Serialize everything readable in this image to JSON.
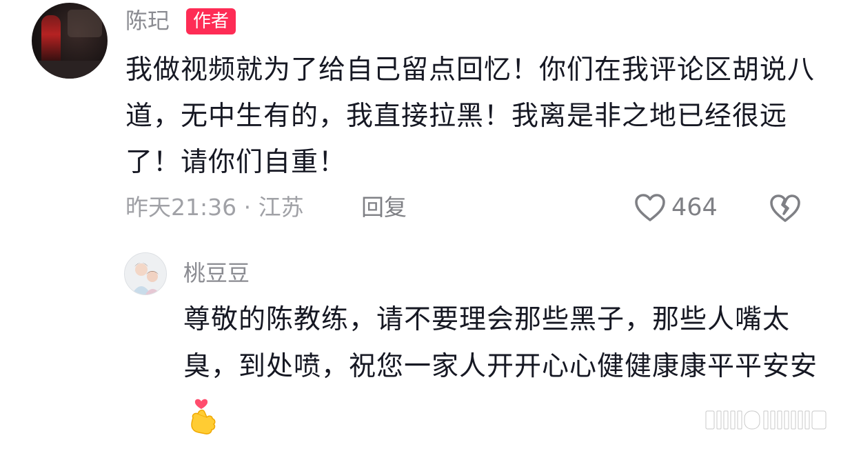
{
  "comment": {
    "author": "陈玘",
    "badge": "作者",
    "text": "我做视频就为了给自己留点回忆！你们在我评论区胡说八道，无中生有的，我直接拉黑！我离是非之地已经很远了！请你们自重！",
    "time_location": "昨天21:36 · 江苏",
    "reply_label": "回复",
    "like_count": "464"
  },
  "reply": {
    "author": "桃豆豆",
    "text": "尊敬的陈教练，请不要理会那些黑子，那些人嘴太臭，到处喷，祝您一家人开开心心健健康康平平安安",
    "emoji": "finger-heart-emoji"
  },
  "icons": {
    "like": "heart-outline-icon",
    "dislike": "broken-heart-icon"
  },
  "colors": {
    "badge_bg": "#fe2c55",
    "text": "#161823",
    "secondary": "#8a8b91"
  }
}
